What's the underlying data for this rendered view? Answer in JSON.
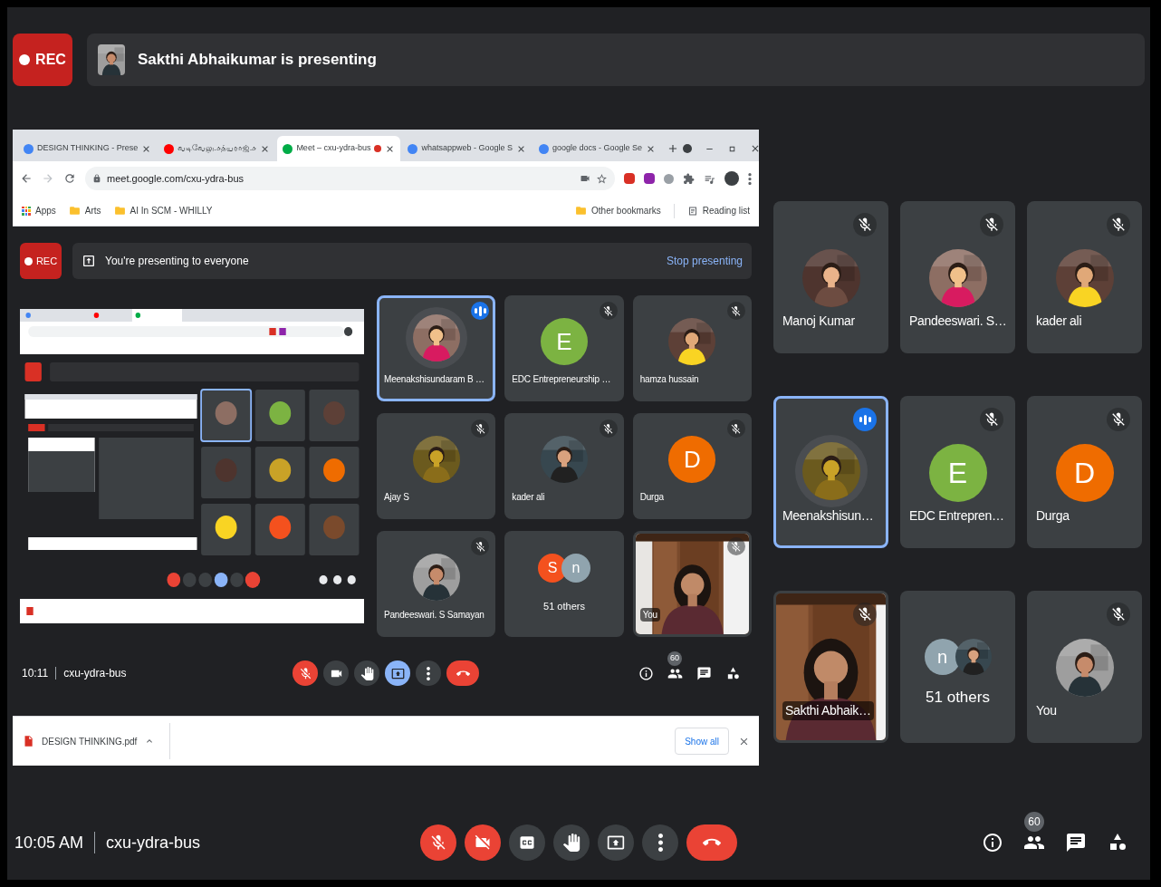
{
  "recording_badge": "REC",
  "presenter_banner": {
    "text": "Sakthi Abhaikumar is presenting"
  },
  "shared_screen": {
    "browser": {
      "tabs": [
        {
          "title": "DESIGN THINKING - Prese",
          "color": "#4285f4",
          "selected": false,
          "recording": false
        },
        {
          "title": "வடிவேலு.சத்யராஜ்.ச",
          "color": "#ff0000",
          "selected": false,
          "recording": false
        },
        {
          "title": "Meet – cxu-ydra-bus",
          "color": "#00ac47",
          "selected": true,
          "recording": true
        },
        {
          "title": "whatsappweb - Google S",
          "color": "#4285f4",
          "selected": false,
          "recording": false
        },
        {
          "title": "google docs - Google Se",
          "color": "#4285f4",
          "selected": false,
          "recording": false
        }
      ],
      "address": "meet.google.com/cxu-ydra-bus",
      "bookmarks": [
        {
          "label": "Apps",
          "kind": "apps"
        },
        {
          "label": "Arts",
          "kind": "folder"
        },
        {
          "label": "AI In SCM - WHILLY",
          "kind": "folder"
        }
      ],
      "bookmarks_right": [
        {
          "label": "Other bookmarks",
          "kind": "folder"
        },
        {
          "label": "Reading list",
          "kind": "reading"
        }
      ]
    },
    "meet": {
      "recording_badge": "REC",
      "banner": "You're presenting to everyone",
      "stop_button": "Stop presenting",
      "tiles": [
        {
          "kind": "avatar",
          "name": "Meenakshisundaram B …",
          "avatar": {
            "kind": "picture"
          },
          "muted": false,
          "speaking": true
        },
        {
          "kind": "avatar",
          "name": "EDC Entrepreneurship …",
          "avatar": {
            "kind": "letter",
            "letter": "E",
            "color": "#7cb342"
          },
          "muted": true,
          "speaking": false
        },
        {
          "kind": "avatar",
          "name": "hamza hussain",
          "avatar": {
            "kind": "picture"
          },
          "muted": true,
          "speaking": false
        },
        {
          "kind": "avatar",
          "name": "Ajay S",
          "avatar": {
            "kind": "picture"
          },
          "muted": true,
          "speaking": false
        },
        {
          "kind": "avatar",
          "name": "kader ali",
          "avatar": {
            "kind": "picture"
          },
          "muted": true,
          "speaking": false
        },
        {
          "kind": "avatar",
          "name": "Durga",
          "avatar": {
            "kind": "letter",
            "letter": "D",
            "color": "#ef6c00"
          },
          "muted": true,
          "speaking": false
        },
        {
          "kind": "avatar",
          "name": "Pandeeswari. S Samayan",
          "avatar": {
            "kind": "picture"
          },
          "muted": true,
          "speaking": false
        },
        {
          "kind": "group",
          "name": "51 others",
          "avatars": [
            {
              "kind": "letter",
              "letter": "S",
              "color": "#f4511e"
            },
            {
              "kind": "letter",
              "letter": "n",
              "color": "#90a4ae"
            }
          ],
          "muted": false,
          "speaking": false
        },
        {
          "kind": "video",
          "name": "You",
          "muted": true,
          "speaking": false
        }
      ],
      "time": "10:11",
      "meeting_code": "cxu-ydra-bus",
      "controls": [
        {
          "kind": "mic",
          "off": true
        },
        {
          "kind": "camera",
          "off": false
        },
        {
          "kind": "hand"
        },
        {
          "kind": "present",
          "active": true
        },
        {
          "kind": "more"
        },
        {
          "kind": "end"
        }
      ],
      "participant_count": "60"
    },
    "download": {
      "file": "DESIGN THINKING.pdf",
      "show_all": "Show all"
    }
  },
  "tiles": [
    {
      "kind": "avatar",
      "name": "Manoj Kumar",
      "avatar": {
        "kind": "picture"
      },
      "muted": true,
      "speaking": false
    },
    {
      "kind": "avatar",
      "name": "Pandeeswari. S…",
      "avatar": {
        "kind": "picture"
      },
      "muted": true,
      "speaking": false
    },
    {
      "kind": "avatar",
      "name": "kader ali",
      "avatar": {
        "kind": "picture"
      },
      "muted": true,
      "speaking": false
    },
    {
      "kind": "avatar",
      "name": "Meenakshisun…",
      "avatar": {
        "kind": "picture"
      },
      "muted": false,
      "speaking": true
    },
    {
      "kind": "avatar",
      "name": "EDC Entrepren…",
      "avatar": {
        "kind": "letter",
        "letter": "E",
        "color": "#7cb342"
      },
      "muted": true,
      "speaking": false
    },
    {
      "kind": "avatar",
      "name": "Durga",
      "avatar": {
        "kind": "letter",
        "letter": "D",
        "color": "#ef6c00"
      },
      "muted": true,
      "speaking": false
    },
    {
      "kind": "video",
      "name": "Sakthi Abhaik…",
      "muted": true,
      "speaking": false
    },
    {
      "kind": "group",
      "name": "51 others",
      "avatars": [
        {
          "kind": "letter",
          "letter": "n",
          "color": "#90a4ae"
        },
        {
          "kind": "picture"
        }
      ],
      "muted": false,
      "speaking": false
    },
    {
      "kind": "avatar",
      "name": "You",
      "avatar": {
        "kind": "picture"
      },
      "muted": true,
      "speaking": false
    }
  ],
  "bottom_bar": {
    "time": "10:05 AM",
    "meeting_code": "cxu-ydra-bus",
    "controls": [
      {
        "kind": "mic",
        "off": true
      },
      {
        "kind": "camera",
        "off": true
      },
      {
        "kind": "captions"
      },
      {
        "kind": "hand"
      },
      {
        "kind": "present",
        "active": false
      },
      {
        "kind": "more"
      },
      {
        "kind": "end"
      }
    ],
    "participant_count": "60"
  }
}
